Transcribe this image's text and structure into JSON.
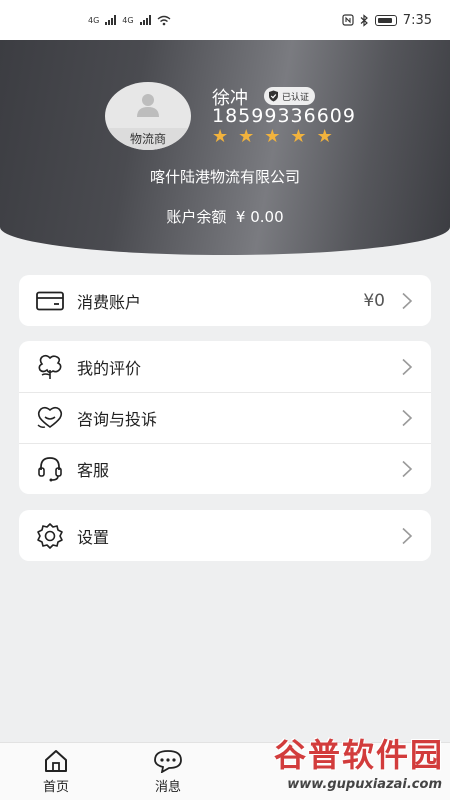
{
  "status_bar": {
    "net_a": "4G",
    "net_b": "4G",
    "time": "7:35"
  },
  "profile": {
    "avatar_tag": "物流商",
    "name": "徐冲",
    "verified_label": "已认证",
    "phone": "18599336609",
    "rating": 5,
    "company": "喀什陆港物流有限公司",
    "balance_label": "账户余额",
    "balance_value": "¥ 0.00"
  },
  "menu": {
    "account": {
      "label": "消费账户",
      "value": "¥0"
    },
    "reviews": {
      "label": "我的评价"
    },
    "complaints": {
      "label": "咨询与投诉"
    },
    "service": {
      "label": "客服"
    },
    "settings": {
      "label": "设置"
    }
  },
  "nav": {
    "home": "首页",
    "messages": "消息"
  },
  "watermark": {
    "title": "谷普软件园",
    "url": "www.gupuxiazai.com"
  },
  "colors": {
    "star": "#f2b33d",
    "header_dark": "#3c3d42",
    "watermark": "#d23c3c"
  },
  "icons": [
    "wallet-icon",
    "flower-icon",
    "chat-heart-icon",
    "headset-icon",
    "gear-icon",
    "home-icon",
    "message-icon",
    "chevron-right-icon",
    "shield-check-icon",
    "person-icon"
  ]
}
